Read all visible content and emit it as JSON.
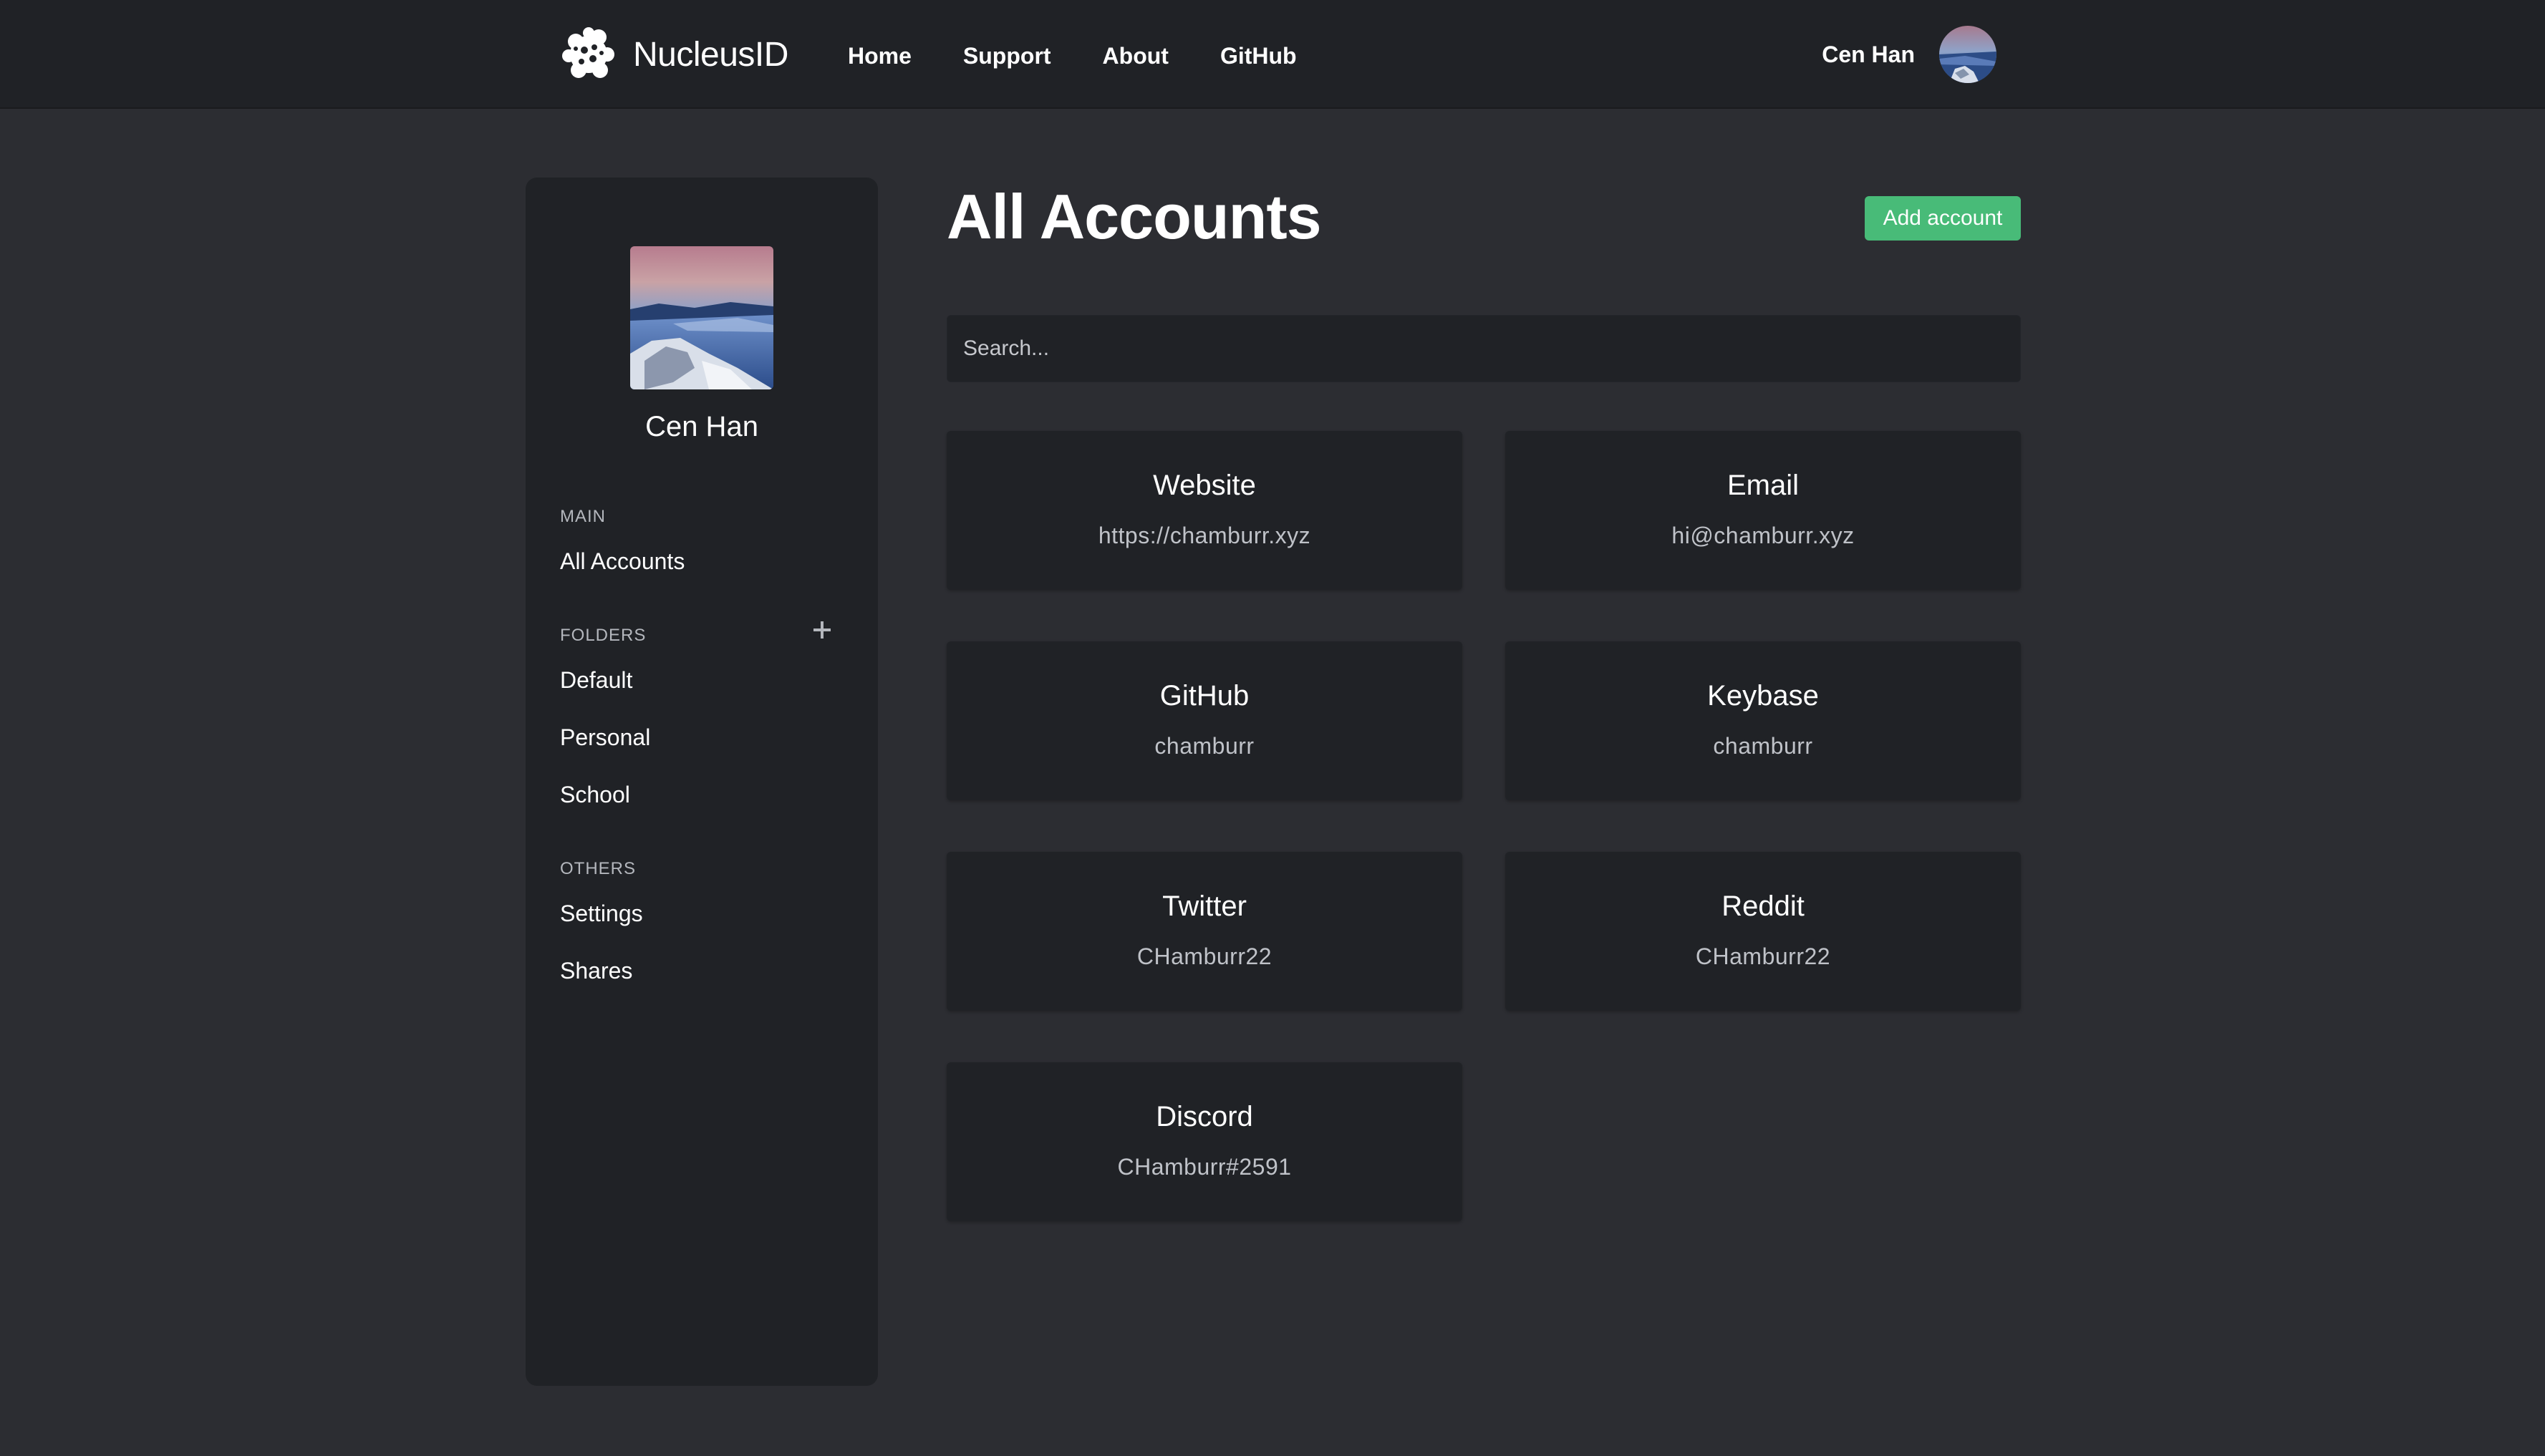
{
  "navbar": {
    "brand": "NucleusID",
    "links": [
      "Home",
      "Support",
      "About",
      "GitHub"
    ],
    "user_name": "Cen Han"
  },
  "sidebar": {
    "profile_name": "Cen Han",
    "sections": {
      "main": "MAIN",
      "folders": "FOLDERS",
      "others": "OTHERS"
    },
    "main_items": [
      "All Accounts"
    ],
    "folder_items": [
      "Default",
      "Personal",
      "School"
    ],
    "other_items": [
      "Settings",
      "Shares"
    ]
  },
  "main": {
    "title": "All Accounts",
    "add_button": "Add account",
    "search_placeholder": "Search..."
  },
  "accounts": [
    {
      "name": "Website",
      "value": "https://chamburr.xyz"
    },
    {
      "name": "Email",
      "value": "hi@chamburr.xyz"
    },
    {
      "name": "GitHub",
      "value": "chamburr"
    },
    {
      "name": "Keybase",
      "value": "chamburr"
    },
    {
      "name": "Twitter",
      "value": "CHamburr22"
    },
    {
      "name": "Reddit",
      "value": "CHamburr22"
    },
    {
      "name": "Discord",
      "value": "CHamburr#2591"
    }
  ],
  "colors": {
    "background": "#2c2d32",
    "panel": "#202226",
    "accent": "#48bb78"
  }
}
